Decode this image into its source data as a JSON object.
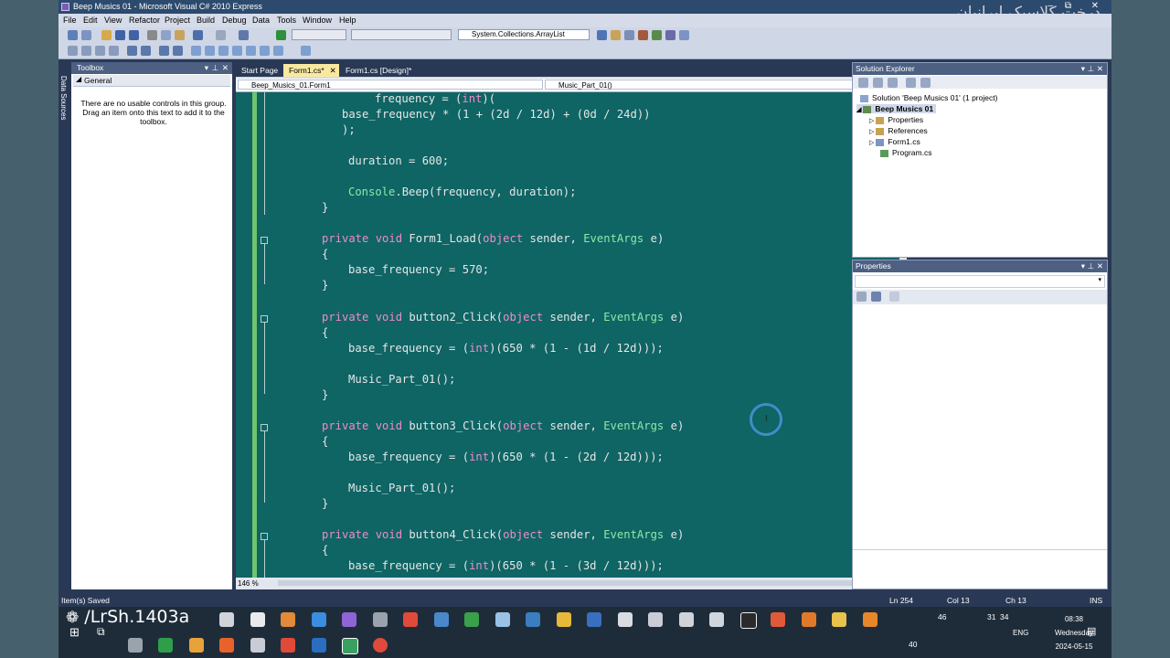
{
  "window": {
    "title": "Beep Musics 01 - Microsoft Visual C# 2010 Express",
    "watermark": "درخت کلاسیک ایرانیان",
    "minimize": "–",
    "maximize": "⧉",
    "close": "✕"
  },
  "menu": [
    "File",
    "Edit",
    "View",
    "Refactor",
    "Project",
    "Build",
    "Debug",
    "Data",
    "Tools",
    "Window",
    "Help"
  ],
  "toolbar": {
    "type_combo": "System.Collections.ArrayList"
  },
  "toolbox": {
    "title": "Toolbox",
    "group": "General",
    "empty_message": "There are no usable controls in this group. Drag an item onto this text to add it to the toolbox.",
    "side_tab": "Data Sources"
  },
  "tabs": [
    {
      "label": "Start Page"
    },
    {
      "label": "Form1.cs*"
    },
    {
      "label": "Form1.cs [Design]*"
    }
  ],
  "navbar": {
    "class_combo": "Beep_Musics_01.Form1",
    "member_combo": "Music_Part_01()"
  },
  "code_lines": [
    "frequency = (int)(",
    "base_frequency * (1 + (2d / 12d) + (0d / 24d))",
    ");",
    "duration = 600;",
    "Console.Beep(frequency, duration);",
    "}",
    "private void Form1_Load(object sender, EventArgs e)",
    "{",
    "base_frequency = 570;",
    "}",
    "private void button2_Click(object sender, EventArgs e)",
    "{",
    "base_frequency = (int)(650 * (1 - (1d / 12d)));",
    "Music_Part_01();",
    "}",
    "private void button3_Click(object sender, EventArgs e)",
    "{",
    "base_frequency = (int)(650 * (1 - (2d / 12d)));",
    "Music_Part_01();",
    "}",
    "private void button4_Click(object sender, EventArgs e)",
    "{",
    "base_frequency = (int)(650 * (1 - (3d / 12d)));"
  ],
  "zoom": "146 %",
  "solution_explorer": {
    "title": "Solution Explorer",
    "solution": "Solution 'Beep Musics 01' (1 project)",
    "project": "Beep Musics 01",
    "items": [
      "Properties",
      "References",
      "Form1.cs",
      "Program.cs"
    ]
  },
  "properties_panel": {
    "title": "Properties"
  },
  "status": {
    "message": "Item(s) Saved",
    "ln": "Ln 254",
    "col": "Col 13",
    "ch": "Ch 13",
    "mode": "INS"
  },
  "taskbar": {
    "channel": "/LrSh.1403a",
    "lang": "ENG",
    "time": "08:38",
    "day": "Wednesday",
    "date": "2024-05-15",
    "tray_num1": "31",
    "tray_num2": "34",
    "tray_num3": "46",
    "tray_num4": "40"
  },
  "colors": {
    "code_bg": "#0f6464",
    "keyword": "#f08cc8",
    "type": "#8ee8a6",
    "chrome": "#293955",
    "active_tab": "#f9e99f"
  }
}
